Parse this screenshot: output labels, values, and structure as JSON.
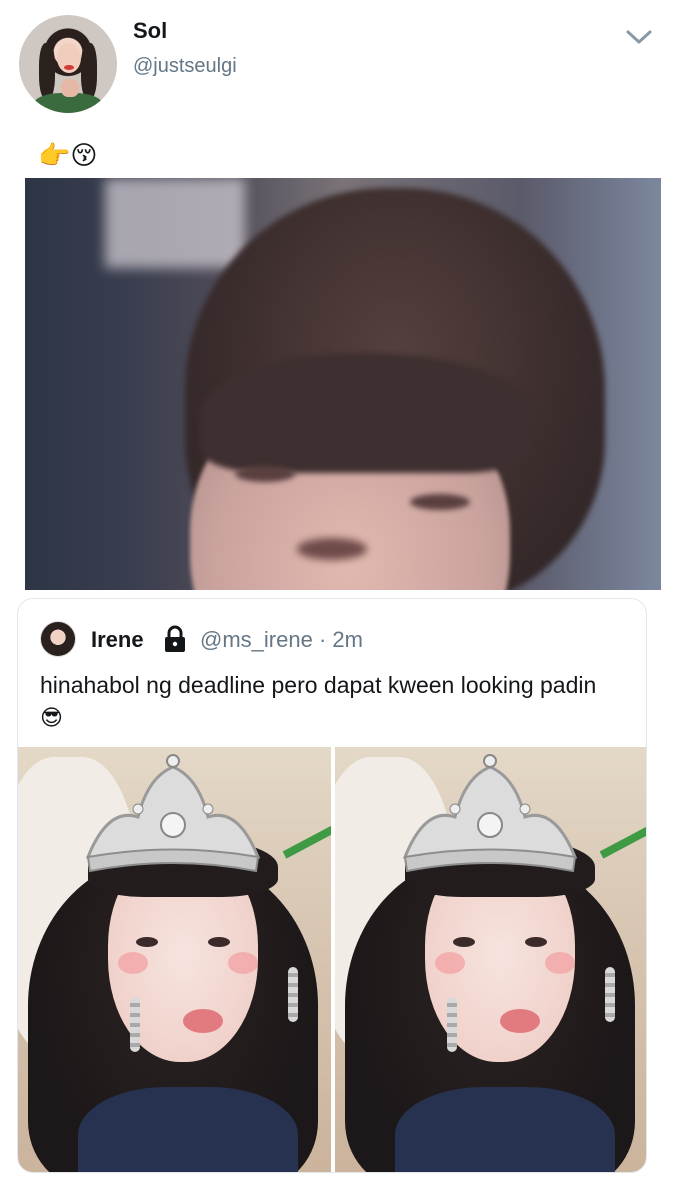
{
  "tweet": {
    "author": {
      "display_name": "Sol",
      "handle": "@justseulgi"
    },
    "text_emoji": "👉😚",
    "colors": {
      "text": "#14171a",
      "secondary": "#657786",
      "border": "#e1e8ed"
    }
  },
  "quoted_tweet": {
    "author": {
      "display_name": "Irene",
      "handle": "@ms_irene",
      "time": "· 2m"
    },
    "text": "hinahabol ng deadline pero dapat kween looking padin",
    "text_emoji": "😎",
    "photo_count": 2
  },
  "icons": {
    "menu": "chevron-down-icon",
    "protected": "lock-icon"
  }
}
